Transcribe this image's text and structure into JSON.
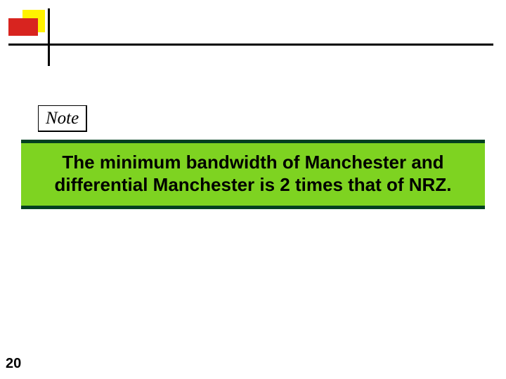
{
  "note": {
    "label": "Note"
  },
  "body": {
    "text": "The minimum bandwidth of Manchester and differential Manchester is 2 times that of NRZ."
  },
  "page": {
    "number": "20"
  }
}
